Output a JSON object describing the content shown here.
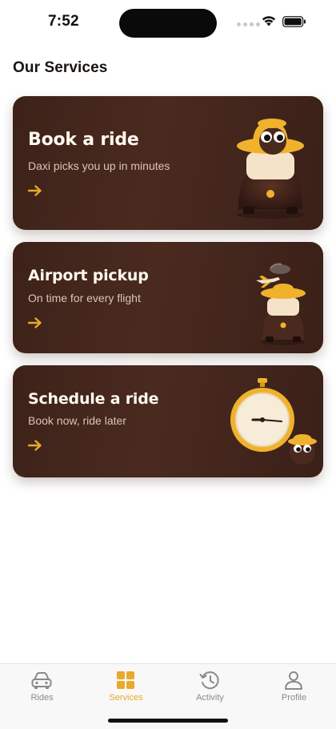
{
  "status_bar": {
    "time": "7:52"
  },
  "page": {
    "title": "Our Services"
  },
  "colors": {
    "accent": "#e9a92a",
    "card_bg": "#42251b",
    "tab_inactive": "#8a8a8a"
  },
  "services": [
    {
      "title": "Book a ride",
      "subtitle": "Daxi picks you up in minutes",
      "icon": "driver-mascot-icon"
    },
    {
      "title": "Airport pickup",
      "subtitle": "On time for every flight",
      "icon": "airport-mascot-icon"
    },
    {
      "title": "Schedule a ride",
      "subtitle": "Book now, ride later",
      "icon": "clock-mascot-icon"
    }
  ],
  "tabs": [
    {
      "label": "Rides",
      "icon": "car-icon",
      "active": false
    },
    {
      "label": "Services",
      "icon": "grid-icon",
      "active": true
    },
    {
      "label": "Activity",
      "icon": "history-icon",
      "active": false
    },
    {
      "label": "Profile",
      "icon": "person-icon",
      "active": false
    }
  ]
}
